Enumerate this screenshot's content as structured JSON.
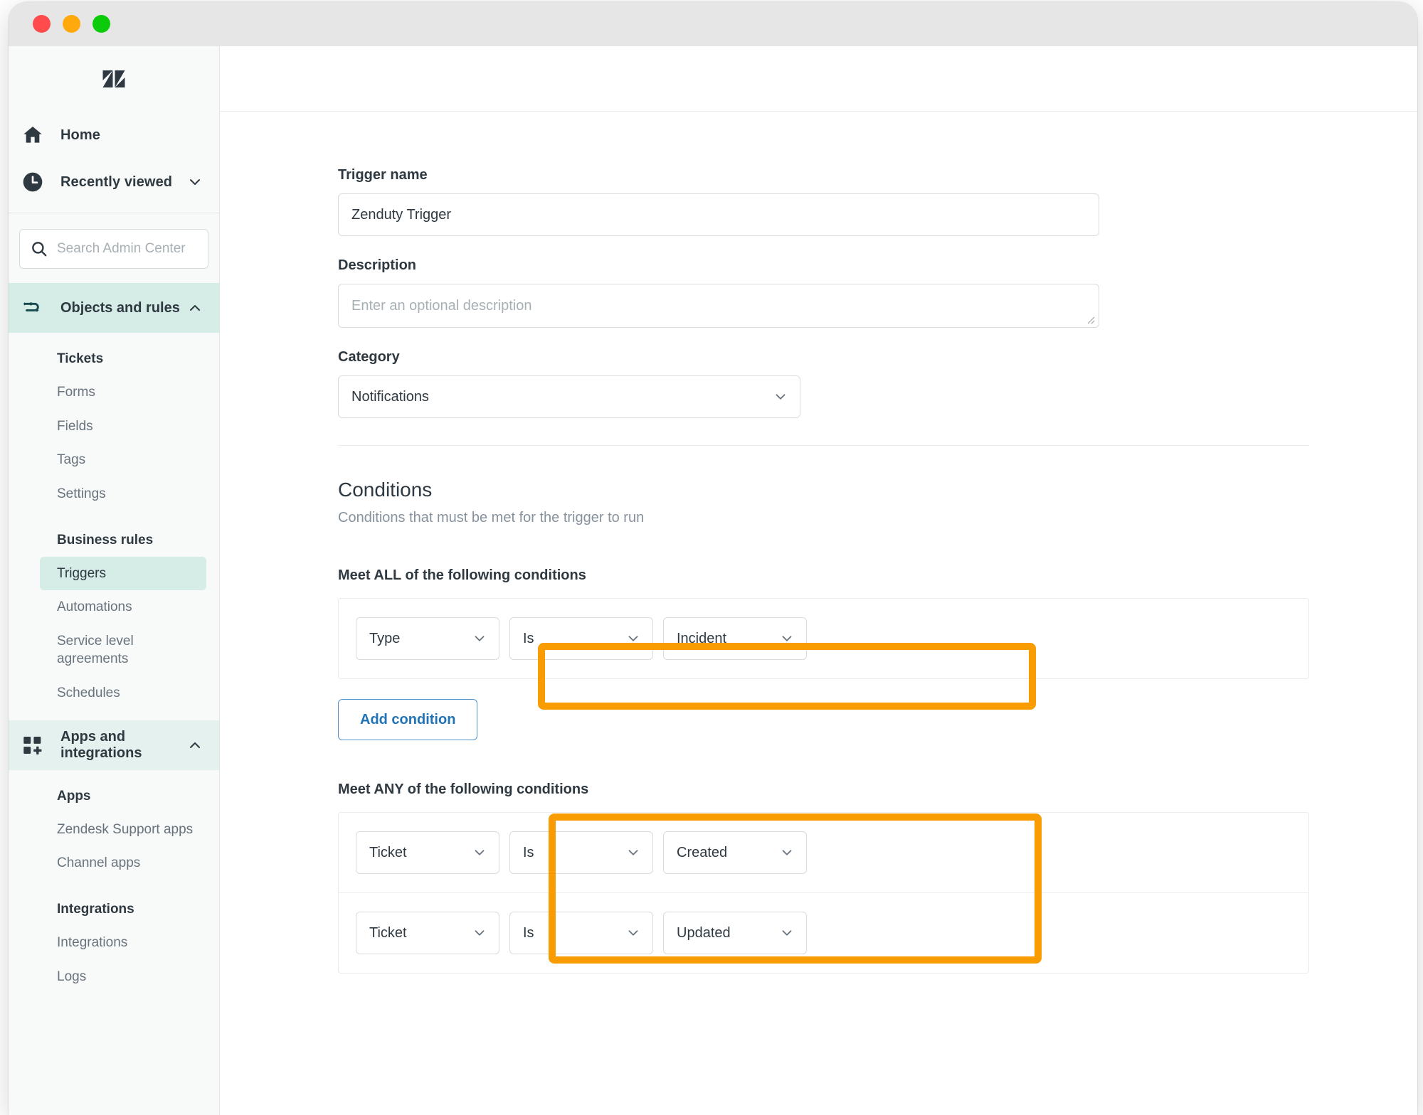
{
  "window": {
    "traffic_lights": [
      "close",
      "minimize",
      "maximize"
    ],
    "colors": {
      "close": "#ff4b4b",
      "minimize": "#ffa90c",
      "maximize": "#0bcb0b"
    }
  },
  "sidebar": {
    "logo": "zendesk-logo",
    "primary": [
      {
        "label": "Home",
        "icon": "home-icon",
        "chevron": false
      },
      {
        "label": "Recently viewed",
        "icon": "clock-icon",
        "chevron": true,
        "chevron_dir": "down"
      }
    ],
    "search": {
      "placeholder": "Search Admin Center",
      "icon": "search-icon"
    },
    "groups": [
      {
        "label": "Objects and rules",
        "icon": "objects-rules-icon",
        "expanded": true,
        "chevron_dir": "up",
        "highlight": "#d5ece7",
        "sections": [
          {
            "heading": "Tickets",
            "items": [
              "Forms",
              "Fields",
              "Tags",
              "Settings"
            ]
          },
          {
            "heading": "Business rules",
            "items": [
              "Triggers",
              "Automations",
              "Service level agreements",
              "Schedules"
            ],
            "selected": "Triggers"
          }
        ]
      },
      {
        "label": "Apps and integrations",
        "icon": "apps-integrations-icon",
        "expanded": true,
        "chevron_dir": "up",
        "highlight": "#e4f1ee",
        "sections": [
          {
            "heading": "Apps",
            "items": [
              "Zendesk Support apps",
              "Channel apps"
            ]
          },
          {
            "heading": "Integrations",
            "items": [
              "Integrations",
              "Logs"
            ]
          }
        ]
      }
    ]
  },
  "form": {
    "trigger_name": {
      "label": "Trigger name",
      "value": "Zenduty Trigger"
    },
    "description": {
      "label": "Description",
      "value": "",
      "placeholder": "Enter an optional description"
    },
    "category": {
      "label": "Category",
      "value": "Notifications",
      "chevron": "chevron-down-icon"
    }
  },
  "conditions": {
    "title": "Conditions",
    "subtitle": "Conditions that must be met for the trigger to run",
    "all": {
      "label": "Meet ALL of the following conditions",
      "rows": [
        {
          "field": "Type",
          "operator": "Is",
          "value": "Incident"
        }
      ],
      "add_button": "Add condition",
      "highlighted": true
    },
    "any": {
      "label": "Meet ANY of the following conditions",
      "rows": [
        {
          "field": "Ticket",
          "operator": "Is",
          "value": "Created"
        },
        {
          "field": "Ticket",
          "operator": "Is",
          "value": "Updated"
        }
      ],
      "highlighted": true
    }
  },
  "annotations": {
    "highlight_color": "#f99c02",
    "boxes": [
      "all-conditions-row",
      "any-conditions-rows"
    ]
  }
}
